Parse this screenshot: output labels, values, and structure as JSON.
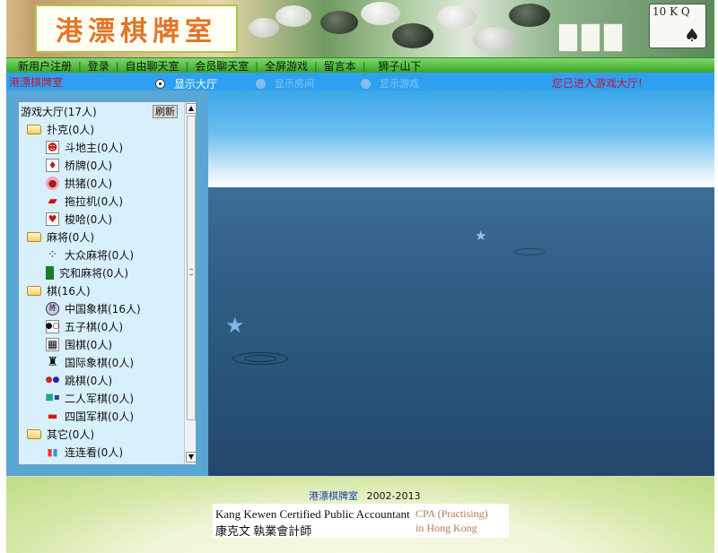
{
  "banner": {
    "logo_text": "港漂棋牌室",
    "card_text": "10 K Q"
  },
  "nav": {
    "items": [
      "新用户注册",
      "登录",
      "自由聊天室",
      "会员聊天室",
      "全屏游戏",
      "留言本",
      "狮子山下"
    ]
  },
  "modebar": {
    "room_name": "港漂棋牌室",
    "options": [
      {
        "label": "显示大厅",
        "selected": true
      },
      {
        "label": "显示房间",
        "selected": false
      },
      {
        "label": "显示游戏",
        "selected": false
      }
    ],
    "status": "您已进入游戏大厅!"
  },
  "lobby": {
    "header": "游戏大厅(17人)",
    "refresh_label": "刷新",
    "categories": [
      {
        "label": "扑克(0人)",
        "games": [
          "斗地主(0人)",
          "桥牌(0人)",
          "拱猪(0人)",
          "拖拉机(0人)",
          "梭哈(0人)"
        ]
      },
      {
        "label": "麻将(0人)",
        "games": [
          "大众麻将(0人)",
          "究和麻将(0人)"
        ]
      },
      {
        "label": "棋(16人)",
        "games": [
          "中国象棋(16人)",
          "五子棋(0人)",
          "围棋(0人)",
          "国际象棋(0人)",
          "跳棋(0人)",
          "二人军棋(0人)",
          "四国军棋(0人)"
        ]
      },
      {
        "label": "其它(0人)",
        "games": [
          "连连看(0人)"
        ]
      }
    ]
  },
  "footer": {
    "site": "港漂棋牌室",
    "years": "2002-2013",
    "cpa_en": "Kang Kewen Certified Public Accountant",
    "cpa_cn": "康克文 執業會計師",
    "cpa_r1": "CPA (Practising)",
    "cpa_r2": "in Hong Kong"
  },
  "colors": {
    "nav_green": "#3aa52a",
    "mode_blue": "#2fa0f0",
    "status_red": "#c81040",
    "panel_blue": "#5aa6d4"
  }
}
